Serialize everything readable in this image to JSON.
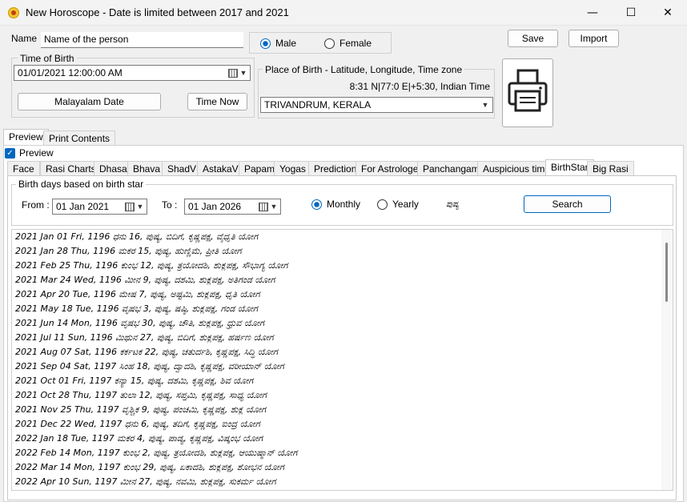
{
  "window": {
    "title": "New Horoscope - Date is limited between 2017 and 2021",
    "minimize": "—",
    "maximize": "☐",
    "close": "✕"
  },
  "form": {
    "name_label": "Name",
    "name_value": "Name of the person",
    "gender": {
      "male": "Male",
      "female": "Female",
      "selected": "Male"
    },
    "save_label": "Save",
    "import_label": "Import",
    "time_of_birth_label": "Time of Birth",
    "time_of_birth_value": "01/01/2021  12:00:00 AM",
    "malayalam_date_label": "Malayalam Date",
    "time_now_label": "Time Now",
    "place_label": "Place of Birth - Latitude, Longitude, Time zone",
    "place_coords": "8:31 N|77:0 E|+5:30, Indian Time",
    "place_value": "TRIVANDRUM, KERALA"
  },
  "outer_tabs": [
    "Preview",
    "Print Contents"
  ],
  "preview_checkbox": "Preview",
  "inner_tabs": [
    "Face",
    "Rasi Charts",
    "Dhasa",
    "Bhava",
    "ShadV",
    "AstakaV",
    "Papam",
    "Yogas",
    "Prediction",
    "For Astrologer",
    "Panchangam",
    "Auspicious time",
    "BirthStar",
    "Big Rasi"
  ],
  "active_inner_tab": "BirthStar",
  "birthstar": {
    "group_label": "Birth days based on birth star",
    "from_label": "From :",
    "from_value": "01 Jan  2021",
    "to_label": "To :",
    "to_value": "01 Jan  2026",
    "monthly_label": "Monthly",
    "yearly_label": "Yearly",
    "selected": "Monthly",
    "star_name": "ಪುಷ್ಯ",
    "search_label": "Search"
  },
  "results": [
    "2021 Jan 01 Fri,  1196 ಧನು  16,  ಪುಷ್ಯ,  ಬಿದಿಗೆ, ಕೃಷ್ಣಪಕ್ಷ,  ವೈಧೃತಿ ಯೋಗ",
    "2021 Jan 28 Thu,  1196 ಮಕರ  15,  ಪುಷ್ಯ,  ಹುಣ್ಣಿಮೆ,  ಪ್ರೀತಿ ಯೋಗ",
    "2021 Feb 25 Thu,  1196 ಕುಂಭ  12,  ಪುಷ್ಯ,  ತ್ರಯೋದಶಿ, ಶುಕ್ಲಪಕ್ಷ,  ಸೌಭಾಗ್ಯ ಯೋಗ",
    "2021 Mar 24 Wed,  1196 ಮೀನ  9,  ಪುಷ್ಯ,  ದಶಮಿ, ಶುಕ್ಲಪಕ್ಷ,  ಅತಿಗಂಡ ಯೋಗ",
    "2021 Apr 20 Tue,  1196 ಮೇಷ  7,  ಪುಷ್ಯ,  ಅಷ್ಟಮಿ, ಶುಕ್ಲಪಕ್ಷ,  ಧೃತಿ ಯೋಗ",
    "2021 May 18 Tue,  1196 ವೃಷಭ  3,  ಪುಷ್ಯ,  ಷಷ್ಠಿ, ಶುಕ್ಲಪಕ್ಷ,  ಗಂಡ ಯೋಗ",
    "2021 Jun 14 Mon,  1196 ವೃಷಭ  30,  ಪುಷ್ಯ,  ಚೌತಿ, ಶುಕ್ಲಪಕ್ಷ,  ಧ್ರುವ ಯೋಗ",
    "2021 Jul 11 Sun,  1196 ಮಿಥುನ  27,  ಪುಷ್ಯ,  ಬಿದಿಗೆ, ಶುಕ್ಲಪಕ್ಷ,  ಹರ್ಷಣ ಯೋಗ",
    "2021 Aug 07 Sat,  1196 ಕರ್ಕಟಕ  22,  ಪುಷ್ಯ,  ಚತುರ್ದಶಿ, ಕೃಷ್ಣಪಕ್ಷ,  ಸಿದ್ಧಿ ಯೋಗ",
    "2021 Sep 04 Sat,  1197 ಸಿಂಹ  18,  ಪುಷ್ಯ,  ದ್ವಾದಶಿ, ಕೃಷ್ಣಪಕ್ಷ,  ವರೀಯಾನ್ ಯೋಗ",
    "2021 Oct 01 Fri,  1197 ಕನ್ಯಾ  15,  ಪುಷ್ಯ,  ದಶಮಿ, ಕೃಷ್ಣಪಕ್ಷ,  ಶಿವ ಯೋಗ",
    "2021 Oct 28 Thu,  1197 ತುಲಾ  12,  ಪುಷ್ಯ,  ಸಪ್ತಮಿ, ಕೃಷ್ಣಪಕ್ಷ,  ಸಾಧ್ಯ ಯೋಗ",
    "2021 Nov 25 Thu,  1197 ವೃಶ್ಚಿಕ  9,  ಪುಷ್ಯ,  ಪಂಚಮಿ, ಕೃಷ್ಣಪಕ್ಷ,  ಶುಕ್ಲ ಯೋಗ",
    "2021 Dec 22 Wed,  1197 ಧನು  6,  ಪುಷ್ಯ,  ತದಿಗೆ, ಕೃಷ್ಣಪಕ್ಷ,  ಐಂದ್ರ ಯೋಗ",
    "2022 Jan 18 Tue,  1197 ಮಕರ  4,  ಪುಷ್ಯ,  ಪಾಡ್ಯ, ಕೃಷ್ಣಪಕ್ಷ,  ವಿಷ್ಕಂಭ ಯೋಗ",
    "2022 Feb 14 Mon,  1197 ಕುಂಭ  2,  ಪುಷ್ಯ,  ತ್ರಯೋದಶಿ, ಶುಕ್ಲಪಕ್ಷ,  ಆಯುಷ್ಮಾನ್ ಯೋಗ",
    "2022 Mar 14 Mon,  1197 ಕುಂಭ  29,  ಪುಷ್ಯ,  ಏಕಾದಶಿ, ಶುಕ್ಲಪಕ್ಷ,  ಶೋಭನ ಯೋಗ",
    "2022 Apr 10 Sun,  1197 ಮೀನ  27,  ಪುಷ್ಯ,  ನವಮಿ, ಶುಕ್ಲಪಕ್ಷ,  ಸುಕರ್ಮ ಯೋಗ"
  ],
  "icons": {
    "app": "horoscope-app-icon",
    "print": "printer-icon",
    "calendar": "calendar-icon",
    "dropdown": "chevron-down-icon"
  },
  "colors": {
    "accent": "#0067c0"
  }
}
